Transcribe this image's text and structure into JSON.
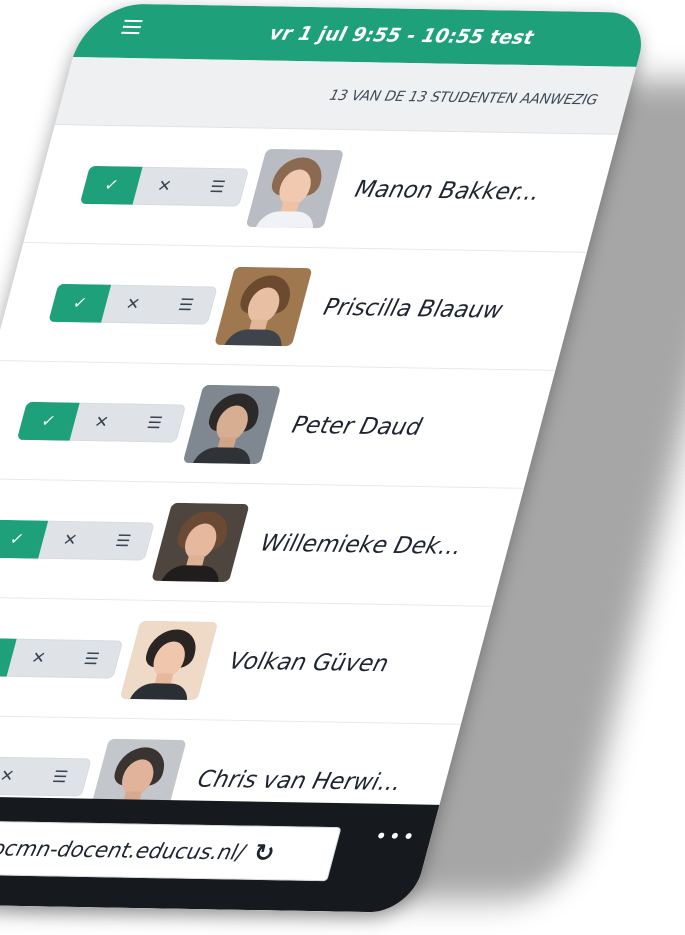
{
  "header": {
    "title": "vr 1 jul 9:55 - 10:55 test"
  },
  "attendance": {
    "summary": "13 VAN DE 13 STUDENTEN AANWEZIG"
  },
  "students": [
    {
      "name": "Manon Bakker..."
    },
    {
      "name": "Priscilla Blaauw"
    },
    {
      "name": "Peter Daud"
    },
    {
      "name": "Willemieke Dek..."
    },
    {
      "name": "Volkan Güven"
    },
    {
      "name": "Chris van Herwi..."
    }
  ],
  "controls": {
    "present_icon": "check-icon",
    "absent_icon": "x-icon",
    "details_icon": "list-icon"
  },
  "browser": {
    "url": "rocmn-docent.educus.nl/"
  },
  "colors": {
    "accent": "#1ea17b",
    "dark_bar": "#161a1e"
  }
}
